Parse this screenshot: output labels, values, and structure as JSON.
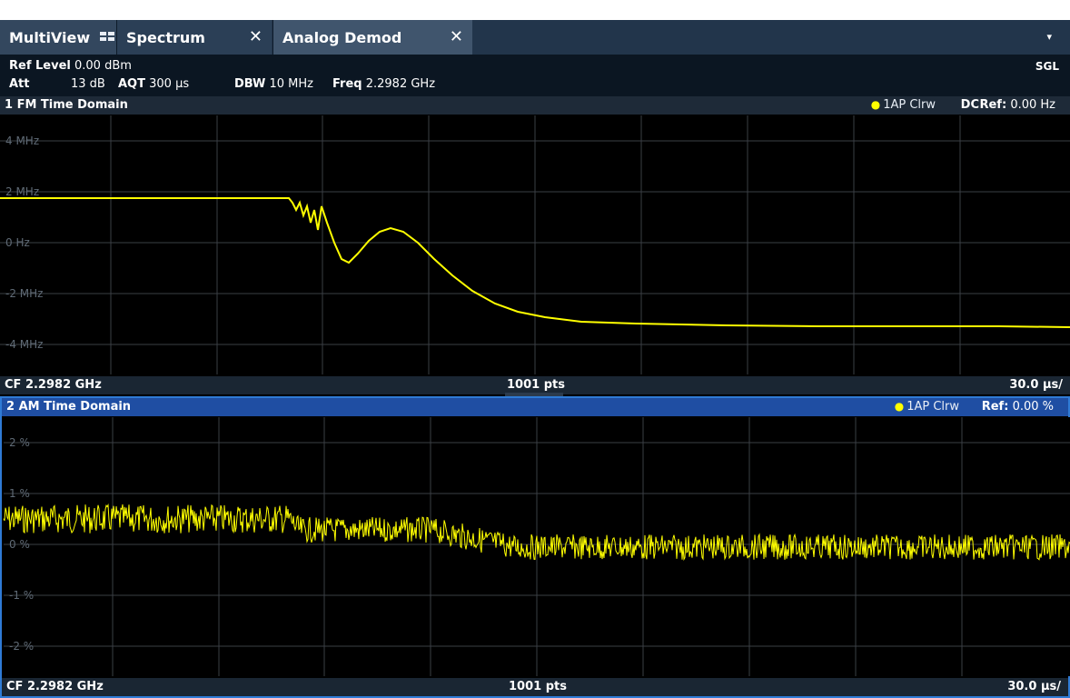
{
  "tabs": {
    "multiview": "MultiView",
    "spectrum": "Spectrum",
    "analog": "Analog Demod",
    "close_glyph": "✕",
    "dropdown_glyph": "▾"
  },
  "info": {
    "ref_level_key": "Ref Level",
    "ref_level_val": "0.00 dBm",
    "att_key": "Att",
    "att_val": "13 dB",
    "aqt_key": "AQT",
    "aqt_val": "300 µs",
    "dbw_key": "DBW",
    "dbw_val": "10 MHz",
    "freq_key": "Freq",
    "freq_val": "2.2982 GHz",
    "mode": "SGL"
  },
  "windows": [
    {
      "title": "1 FM Time Domain",
      "trace": "1AP Clrw",
      "coupling": "DC",
      "ref_key": "Ref:",
      "ref_val": "0.00 Hz",
      "footer_left": "CF 2.2982 GHz",
      "footer_center": "1001 pts",
      "footer_right": "30.0 µs/",
      "y_labels": [
        "4 MHz",
        "2 MHz",
        "0 Hz",
        "-2 MHz",
        "-4 MHz"
      ]
    },
    {
      "title": "2 AM Time Domain",
      "trace": "1AP Clrw",
      "ref_key": "Ref:",
      "ref_val": "0.00 %",
      "footer_left": "CF 2.2982 GHz",
      "footer_center": "1001 pts",
      "footer_right": "30.0 µs/",
      "y_labels": [
        "2 %",
        "1 %",
        "0 %",
        "-1 %",
        "-2 %"
      ]
    }
  ],
  "colors": {
    "trace": "#ffff00",
    "grid": "#3a3f45",
    "active_border": "#2f7bd6"
  }
}
